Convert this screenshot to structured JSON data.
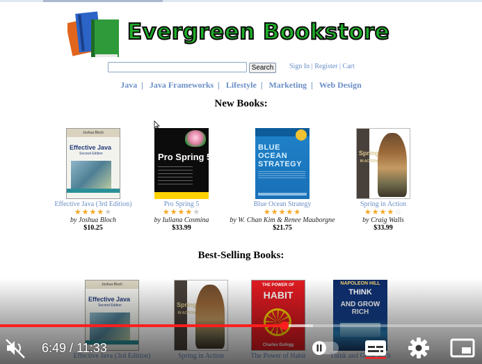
{
  "header": {
    "title": "Evergreen Bookstore",
    "search": {
      "value": "",
      "placeholder": "",
      "button_label": "Search"
    },
    "account_links": [
      "Sign In",
      "Register",
      "Cart"
    ],
    "categories": [
      "Java",
      "Java Frameworks",
      "Lifestyle",
      "Marketing",
      "Web Design"
    ]
  },
  "new_books": {
    "heading": "New Books:",
    "items": [
      {
        "title": "Effective Java (3rd Edition)",
        "author": "by Joshua Bloch",
        "price": "$10.25",
        "rating": 4.5,
        "cover": {
          "header": "Joshua Bloch",
          "title": "Effective Java",
          "subtitle": "Second Edition"
        }
      },
      {
        "title": "Pro Spring 5",
        "author": "by Iuliana Cosmina",
        "price": "$33.99",
        "rating": 4.5,
        "cover": {
          "title": "Pro Spring 5"
        }
      },
      {
        "title": "Blue Ocean Strategy",
        "author": "by W. Chan Kim & Renee Mauborgne",
        "price": "$21.75",
        "rating": 5,
        "cover": {
          "line1": "BLUE",
          "line2": "OCEAN",
          "line3": "STRATEGY"
        }
      },
      {
        "title": "Spring in Action",
        "author": "by Craig Walls",
        "price": "$33.99",
        "rating": 4,
        "cover": {
          "title_line1": "Spring",
          "title_line2": "IN ACTION"
        }
      }
    ]
  },
  "best_selling": {
    "heading": "Best-Selling Books:",
    "items": [
      {
        "title": "Effective Java (3rd Edition)",
        "cover": {
          "header": "Joshua Bloch",
          "title": "Effective Java",
          "subtitle": "Second Edition"
        }
      },
      {
        "title": "Spring in Action",
        "cover": {
          "title_line1": "Spring",
          "title_line2": "IN ACTION"
        }
      },
      {
        "title": "The Power of Habit",
        "cover": {
          "line1": "THE POWER OF",
          "line2": "HABIT",
          "author": "Charles Duhigg"
        }
      },
      {
        "title": "Think and Grow Rich",
        "cover": {
          "name": "NAPOLEON HILL",
          "line1": "THINK",
          "line2": "AND GROW RICH"
        }
      }
    ]
  },
  "player": {
    "current_time": "6:49",
    "duration": "11:33",
    "progress_fraction": 0.59,
    "buffered_fraction": 0.65,
    "accent_color": "#ff1e1e",
    "icons": [
      "mute-icon",
      "pause-toggle-icon",
      "subtitles-icon",
      "settings-icon",
      "miniplayer-icon"
    ]
  }
}
